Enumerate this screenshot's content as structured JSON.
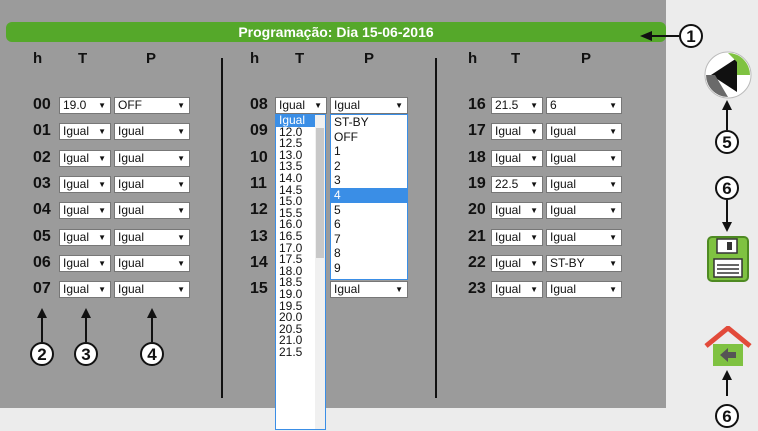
{
  "title": "Programação: Dia 15-06-2016",
  "headers": {
    "h": "h",
    "t": "T",
    "p": "P"
  },
  "columns": [
    {
      "rows": [
        {
          "hour": "00",
          "t": "19.0",
          "p": "OFF"
        },
        {
          "hour": "01",
          "t": "Igual",
          "p": "Igual"
        },
        {
          "hour": "02",
          "t": "Igual",
          "p": "Igual"
        },
        {
          "hour": "03",
          "t": "Igual",
          "p": "Igual"
        },
        {
          "hour": "04",
          "t": "Igual",
          "p": "Igual"
        },
        {
          "hour": "05",
          "t": "Igual",
          "p": "Igual"
        },
        {
          "hour": "06",
          "t": "Igual",
          "p": "Igual"
        },
        {
          "hour": "07",
          "t": "Igual",
          "p": "Igual"
        }
      ]
    },
    {
      "rows": [
        {
          "hour": "08",
          "t": "Igual",
          "p": "Igual"
        },
        {
          "hour": "09",
          "t": "",
          "p": ""
        },
        {
          "hour": "10",
          "t": "",
          "p": ""
        },
        {
          "hour": "11",
          "t": "",
          "p": ""
        },
        {
          "hour": "12",
          "t": "",
          "p": ""
        },
        {
          "hour": "13",
          "t": "",
          "p": ""
        },
        {
          "hour": "14",
          "t": "",
          "p": ""
        },
        {
          "hour": "15",
          "t": "",
          "p": "Igual"
        }
      ]
    },
    {
      "rows": [
        {
          "hour": "16",
          "t": "21.5",
          "p": "6"
        },
        {
          "hour": "17",
          "t": "Igual",
          "p": "Igual"
        },
        {
          "hour": "18",
          "t": "Igual",
          "p": "Igual"
        },
        {
          "hour": "19",
          "t": "22.5",
          "p": "Igual"
        },
        {
          "hour": "20",
          "t": "Igual",
          "p": "Igual"
        },
        {
          "hour": "21",
          "t": "Igual",
          "p": "Igual"
        },
        {
          "hour": "22",
          "t": "Igual",
          "p": "ST-BY"
        },
        {
          "hour": "23",
          "t": "Igual",
          "p": "Igual"
        }
      ]
    }
  ],
  "t_dropdown": {
    "options": [
      "Igual",
      "12.0",
      "12.5",
      "13.0",
      "13.5",
      "14.0",
      "14.5",
      "15.0",
      "15.5",
      "16.0",
      "16.5",
      "17.0",
      "17.5",
      "18.0",
      "18.5",
      "19.0",
      "19.5",
      "20.0",
      "20.5",
      "21.0",
      "21.5"
    ],
    "selected": "Igual"
  },
  "p_dropdown": {
    "options": [
      "ST-BY",
      "OFF",
      "1",
      "2",
      "3",
      "4",
      "5",
      "6",
      "7",
      "8",
      "9"
    ],
    "selected": "4"
  },
  "callouts": [
    "1",
    "2",
    "3",
    "4",
    "5",
    "6",
    "6"
  ],
  "colors": {
    "title_bar": "#55a82a",
    "panel": "#9b9b9b",
    "highlight": "#3a8ee6",
    "icon_green": "#7fc241"
  },
  "icons": {
    "back": "back-arrow-icon",
    "save": "floppy-save-icon",
    "home": "home-icon"
  }
}
